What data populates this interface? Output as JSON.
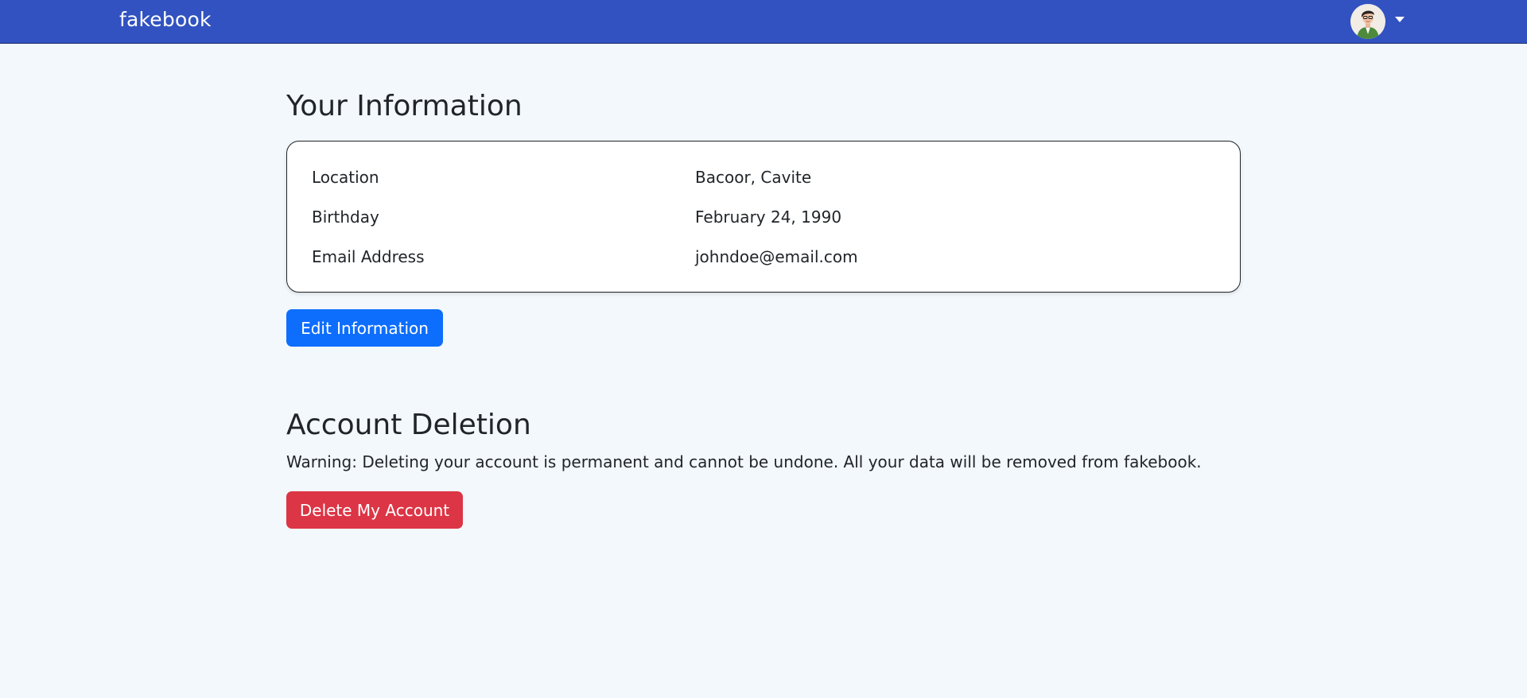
{
  "navbar": {
    "brand": "fakebook",
    "avatar_icon": "user-avatar",
    "dropdown_icon": "caret-down-icon"
  },
  "info_section": {
    "title": "Your Information",
    "rows": [
      {
        "label": "Location",
        "value": "Bacoor, Cavite"
      },
      {
        "label": "Birthday",
        "value": "February 24, 1990"
      },
      {
        "label": "Email Address",
        "value": "johndoe@email.com"
      }
    ],
    "edit_button_label": "Edit Information"
  },
  "deletion_section": {
    "title": "Account Deletion",
    "warning": "Warning: Deleting your account is permanent and cannot be undone. All your data will be removed from fakebook.",
    "delete_button_label": "Delete My Account"
  },
  "colors": {
    "navbar": "#3152c0",
    "background": "#f2f8fc",
    "primary_button": "#0d6efd",
    "danger_button": "#dc3545"
  }
}
